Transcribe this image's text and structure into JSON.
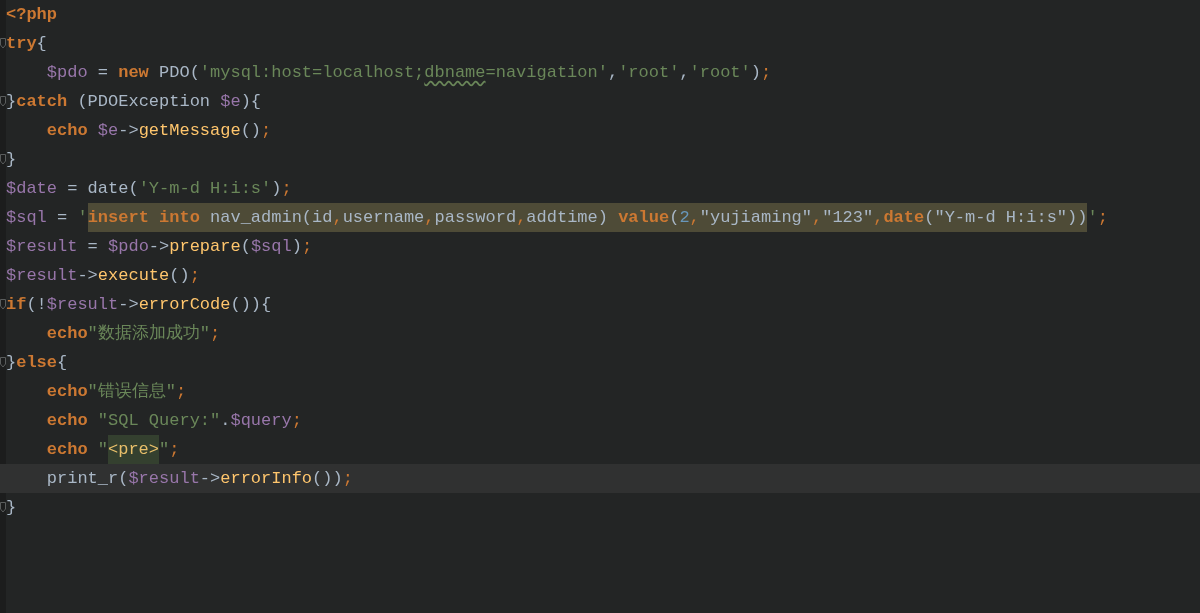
{
  "editor": {
    "lines": [
      {
        "fold": false,
        "current": false,
        "tokens": [
          {
            "kind": "keyword",
            "text": "<?php"
          }
        ]
      },
      {
        "fold": true,
        "current": false,
        "tokens": [
          {
            "kind": "keyword",
            "text": "try"
          },
          {
            "kind": "plain",
            "text": "{"
          }
        ],
        "children": [
          {
            "fold": false,
            "current": false,
            "tokens": [
              {
                "kind": "variable",
                "text": "$pdo"
              },
              {
                "kind": "plain",
                "text": " = "
              },
              {
                "kind": "keyword",
                "text": "new"
              },
              {
                "kind": "plain",
                "text": " PDO("
              },
              {
                "kind": "string",
                "text": "'mysql:host=localhost;"
              },
              {
                "kind": "string",
                "text": "dbname",
                "typo": true
              },
              {
                "kind": "string",
                "text": "=navigation'"
              },
              {
                "kind": "plain",
                "text": ","
              },
              {
                "kind": "string",
                "text": "'root'"
              },
              {
                "kind": "plain",
                "text": ","
              },
              {
                "kind": "string",
                "text": "'root'"
              },
              {
                "kind": "plain",
                "text": ")"
              },
              {
                "kind": "semicolon",
                "text": ";"
              }
            ]
          }
        ]
      },
      {
        "fold": true,
        "current": false,
        "tokens": [
          {
            "kind": "plain",
            "text": "}"
          },
          {
            "kind": "keyword",
            "text": "catch"
          },
          {
            "kind": "plain",
            "text": " (PDOException "
          },
          {
            "kind": "variable",
            "text": "$e"
          },
          {
            "kind": "plain",
            "text": "){"
          }
        ],
        "children": [
          {
            "fold": false,
            "current": false,
            "tokens": [
              {
                "kind": "keyword",
                "text": "echo "
              },
              {
                "kind": "variable",
                "text": "$e"
              },
              {
                "kind": "plain",
                "text": "->"
              },
              {
                "kind": "function",
                "text": "getMessage"
              },
              {
                "kind": "plain",
                "text": "()"
              },
              {
                "kind": "semicolon",
                "text": ";"
              }
            ]
          }
        ]
      },
      {
        "fold": true,
        "current": false,
        "tokens": [
          {
            "kind": "plain",
            "text": "}"
          }
        ]
      },
      {
        "fold": false,
        "current": false,
        "tokens": [
          {
            "kind": "variable",
            "text": "$date"
          },
          {
            "kind": "plain",
            "text": " = date("
          },
          {
            "kind": "string",
            "text": "'Y-m-d H:i:s'"
          },
          {
            "kind": "plain",
            "text": ")"
          },
          {
            "kind": "semicolon",
            "text": ";"
          }
        ]
      },
      {
        "fold": false,
        "current": false,
        "tokens": [
          {
            "kind": "variable",
            "text": "$sql"
          },
          {
            "kind": "plain",
            "text": " = "
          },
          {
            "kind": "string",
            "text": "'"
          },
          {
            "kind": "keyword",
            "text": "insert into",
            "highlighted": true
          },
          {
            "kind": "plain",
            "text": " nav_admin(id",
            "highlighted": true
          },
          {
            "kind": "semicolon",
            "text": ",",
            "highlighted": true
          },
          {
            "kind": "plain",
            "text": "username",
            "highlighted": true
          },
          {
            "kind": "semicolon",
            "text": ",",
            "highlighted": true
          },
          {
            "kind": "plain",
            "text": "password",
            "highlighted": true
          },
          {
            "kind": "semicolon",
            "text": ",",
            "highlighted": true
          },
          {
            "kind": "plain",
            "text": "addtime) ",
            "highlighted": true
          },
          {
            "kind": "keyword",
            "text": "value",
            "highlighted": true
          },
          {
            "kind": "plain",
            "text": "(",
            "highlighted": true
          },
          {
            "kind": "number",
            "text": "2",
            "highlighted": true
          },
          {
            "kind": "semicolon",
            "text": ",",
            "highlighted": true
          },
          {
            "kind": "plain",
            "text": "\"yujiaming\"",
            "highlighted": true
          },
          {
            "kind": "semicolon",
            "text": ",",
            "highlighted": true
          },
          {
            "kind": "plain",
            "text": "\"123\"",
            "highlighted": true
          },
          {
            "kind": "semicolon",
            "text": ",",
            "highlighted": true
          },
          {
            "kind": "keyword",
            "text": "date",
            "highlighted": true
          },
          {
            "kind": "plain",
            "text": "(\"Y-m-d H:i:s\"))",
            "highlighted": true
          },
          {
            "kind": "string",
            "text": "'"
          },
          {
            "kind": "semicolon",
            "text": ";"
          }
        ]
      },
      {
        "fold": false,
        "current": false,
        "tokens": [
          {
            "kind": "variable",
            "text": "$result"
          },
          {
            "kind": "plain",
            "text": " = "
          },
          {
            "kind": "variable",
            "text": "$pdo"
          },
          {
            "kind": "plain",
            "text": "->"
          },
          {
            "kind": "function",
            "text": "prepare"
          },
          {
            "kind": "plain",
            "text": "("
          },
          {
            "kind": "variable",
            "text": "$sql"
          },
          {
            "kind": "plain",
            "text": ")"
          },
          {
            "kind": "semicolon",
            "text": ";"
          }
        ]
      },
      {
        "fold": false,
        "current": false,
        "tokens": [
          {
            "kind": "variable",
            "text": "$result"
          },
          {
            "kind": "plain",
            "text": "->"
          },
          {
            "kind": "function",
            "text": "execute"
          },
          {
            "kind": "plain",
            "text": "()"
          },
          {
            "kind": "semicolon",
            "text": ";"
          }
        ]
      },
      {
        "fold": true,
        "current": false,
        "tokens": [
          {
            "kind": "keyword",
            "text": "if"
          },
          {
            "kind": "plain",
            "text": "(!"
          },
          {
            "kind": "variable",
            "text": "$result"
          },
          {
            "kind": "plain",
            "text": "->"
          },
          {
            "kind": "function",
            "text": "errorCode"
          },
          {
            "kind": "plain",
            "text": "()){"
          }
        ],
        "children": [
          {
            "fold": false,
            "current": false,
            "tokens": [
              {
                "kind": "keyword",
                "text": "echo"
              },
              {
                "kind": "string",
                "text": "\"数据添加成功\""
              },
              {
                "kind": "semicolon",
                "text": ";"
              }
            ]
          }
        ]
      },
      {
        "fold": true,
        "current": false,
        "tokens": [
          {
            "kind": "plain",
            "text": "}"
          },
          {
            "kind": "keyword",
            "text": "else"
          },
          {
            "kind": "plain",
            "text": "{"
          }
        ],
        "children": [
          {
            "fold": false,
            "current": false,
            "tokens": [
              {
                "kind": "keyword",
                "text": "echo"
              },
              {
                "kind": "string",
                "text": "\"错误信息\""
              },
              {
                "kind": "semicolon",
                "text": ";"
              }
            ]
          },
          {
            "fold": false,
            "current": false,
            "tokens": [
              {
                "kind": "keyword",
                "text": "echo "
              },
              {
                "kind": "string",
                "text": "\"SQL Query:\""
              },
              {
                "kind": "plain",
                "text": "."
              },
              {
                "kind": "variable",
                "text": "$query"
              },
              {
                "kind": "semicolon",
                "text": ";"
              }
            ]
          },
          {
            "fold": false,
            "current": false,
            "tokens": [
              {
                "kind": "keyword",
                "text": "echo "
              },
              {
                "kind": "string",
                "text": "\""
              },
              {
                "kind": "tag",
                "text": "<pre>",
                "highlighted": true
              },
              {
                "kind": "string",
                "text": "\""
              },
              {
                "kind": "semicolon",
                "text": ";"
              }
            ]
          },
          {
            "fold": false,
            "current": true,
            "tokens": [
              {
                "kind": "plain",
                "text": "print_r("
              },
              {
                "kind": "variable",
                "text": "$result"
              },
              {
                "kind": "plain",
                "text": "->"
              },
              {
                "kind": "function",
                "text": "errorInfo"
              },
              {
                "kind": "plain",
                "text": "())"
              },
              {
                "kind": "semicolon",
                "text": ";"
              }
            ]
          }
        ]
      },
      {
        "fold": true,
        "current": false,
        "tokens": [
          {
            "kind": "plain",
            "text": "}"
          }
        ]
      }
    ]
  }
}
